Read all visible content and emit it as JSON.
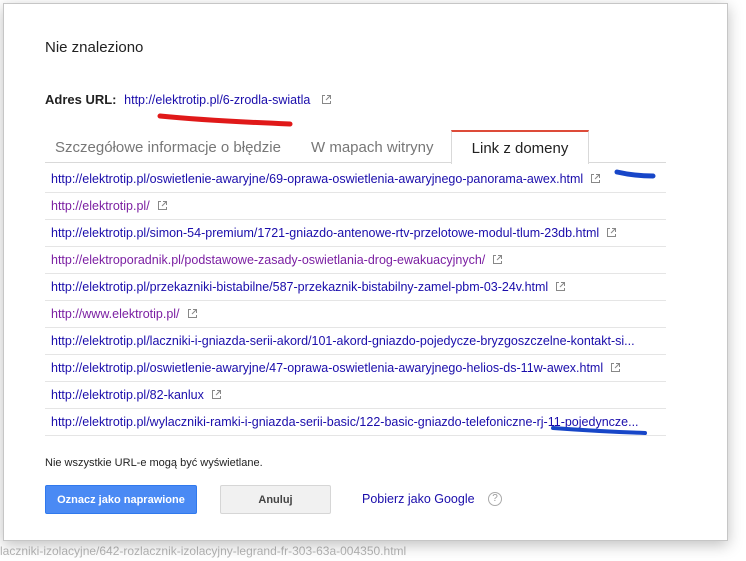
{
  "background": {
    "partial_url": "laczniki-izolacyjne/642-rozlacznik-izolacyjny-legrand-fr-303-63a-004350.html"
  },
  "dialog": {
    "title": "Nie znaleziono",
    "url_label": "Adres URL:",
    "url": "http://elektrotip.pl/6-zrodla-swiatla",
    "tabs": [
      {
        "label": "Szczegółowe informacje o błędzie"
      },
      {
        "label": "W mapach witryny"
      },
      {
        "label": "Link z domeny"
      }
    ],
    "active_tab": "Link z domeny",
    "links": [
      {
        "text": "http://elektrotip.pl/oswietlenie-awaryjne/69-oprawa-oswietlenia-awaryjnego-panorama-awex.html",
        "visited": false
      },
      {
        "text": "http://elektrotip.pl/",
        "visited": true
      },
      {
        "text": "http://elektrotip.pl/simon-54-premium/1721-gniazdo-antenowe-rtv-przelotowe-modul-tlum-23db.html",
        "visited": false
      },
      {
        "text": "http://elektroporadnik.pl/podstawowe-zasady-oswietlania-drog-ewakuacyjnych/",
        "visited": true
      },
      {
        "text": "http://elektrotip.pl/przekazniki-bistabilne/587-przekaznik-bistabilny-zamel-pbm-03-24v.html",
        "visited": false
      },
      {
        "text": "http://www.elektrotip.pl/",
        "visited": true
      },
      {
        "text": "http://elektrotip.pl/laczniki-i-gniazda-serii-akord/101-akord-gniazdo-pojedycze-bryzgoszczelne-kontakt-si...",
        "visited": false
      },
      {
        "text": "http://elektrotip.pl/oswietlenie-awaryjne/47-oprawa-oswietlenia-awaryjnego-helios-ds-11w-awex.html",
        "visited": false
      },
      {
        "text": "http://elektrotip.pl/82-kanlux",
        "visited": false
      },
      {
        "text": "http://elektrotip.pl/wylaczniki-ramki-i-gniazda-serii-basic/122-basic-gniazdo-telefoniczne-rj-11-pojedyncze...",
        "visited": false
      }
    ],
    "note": "Nie wszystkie URL-e mogą być wyświetlane.",
    "primary_button": "Oznacz jako naprawione",
    "cancel_button": "Anuluj",
    "fetch_link": "Pobierz jako Google",
    "help_icon": "?"
  },
  "colors": {
    "link_blue": "#1a0dab",
    "link_visited": "#7b1fa2",
    "primary_button": "#4a8af4",
    "active_tab_border": "#dd4b39",
    "annotation_red": "#e01919",
    "annotation_blue": "#1746c8"
  },
  "icons": {
    "external_link": "external-link-icon",
    "help": "help-icon"
  }
}
